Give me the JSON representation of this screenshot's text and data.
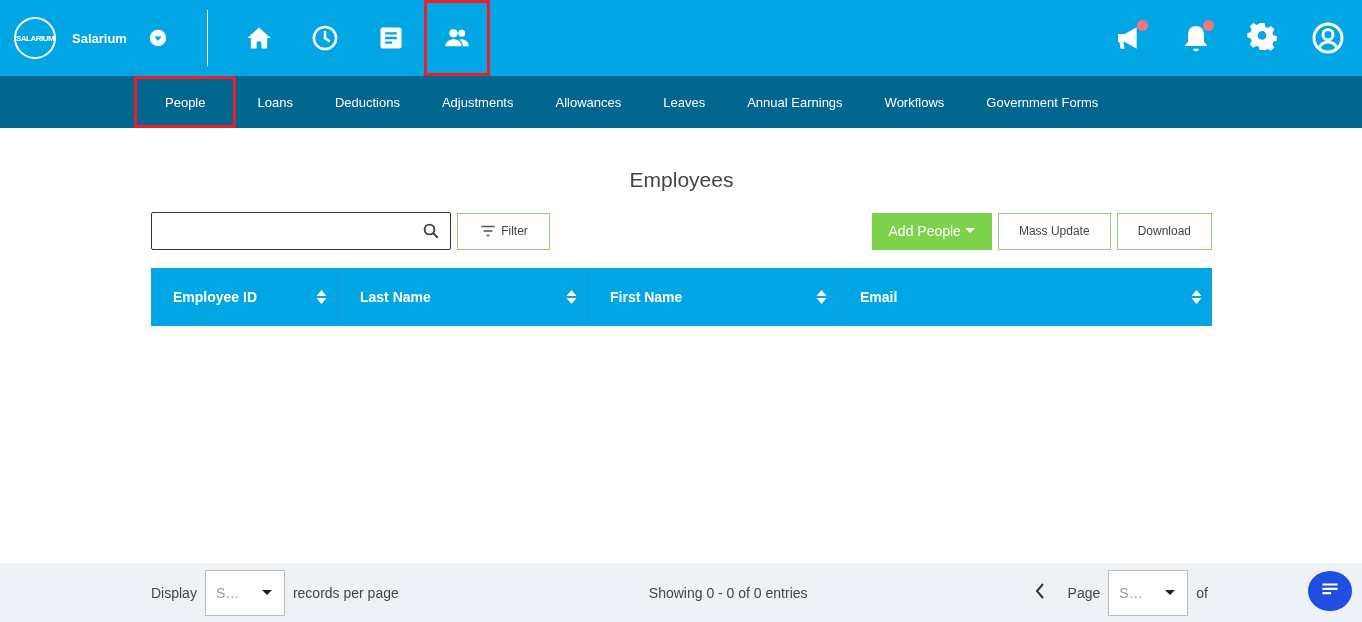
{
  "brand": {
    "logo_text": "SALARIUM",
    "name": "Salarium"
  },
  "nav_icons": [
    {
      "kind": "home",
      "highlighted": false
    },
    {
      "kind": "clock",
      "highlighted": false
    },
    {
      "kind": "document",
      "highlighted": false
    },
    {
      "kind": "people",
      "highlighted": true
    }
  ],
  "header_actions": [
    {
      "kind": "megaphone",
      "unread": true
    },
    {
      "kind": "bell",
      "unread": true
    },
    {
      "kind": "settings",
      "unread": false
    },
    {
      "kind": "account",
      "unread": false
    }
  ],
  "subnav": [
    {
      "label": "People",
      "selected": true,
      "highlighted": true
    },
    {
      "label": "Loans",
      "selected": false,
      "highlighted": false
    },
    {
      "label": "Deductions",
      "selected": false,
      "highlighted": false
    },
    {
      "label": "Adjustments",
      "selected": false,
      "highlighted": false
    },
    {
      "label": "Allowances",
      "selected": false,
      "highlighted": false
    },
    {
      "label": "Leaves",
      "selected": false,
      "highlighted": false
    },
    {
      "label": "Annual Earnings",
      "selected": false,
      "highlighted": false
    },
    {
      "label": "Workflows",
      "selected": false,
      "highlighted": false
    },
    {
      "label": "Government Forms",
      "selected": false,
      "highlighted": false
    }
  ],
  "page_title": "Employees",
  "toolbar": {
    "filter": "Filter",
    "add": "Add People",
    "buttons": [
      "Mass Update",
      "Download"
    ]
  },
  "table": {
    "columns": [
      "Employee ID",
      "Last Name",
      "First Name",
      "Email"
    ]
  },
  "footer": {
    "display": "Display",
    "per_page_value": "S…",
    "per_page_label": "records per page",
    "showing": "Showing 0 - 0 of 0 entries",
    "page": "Page",
    "page_value": "S…",
    "of": "of"
  }
}
